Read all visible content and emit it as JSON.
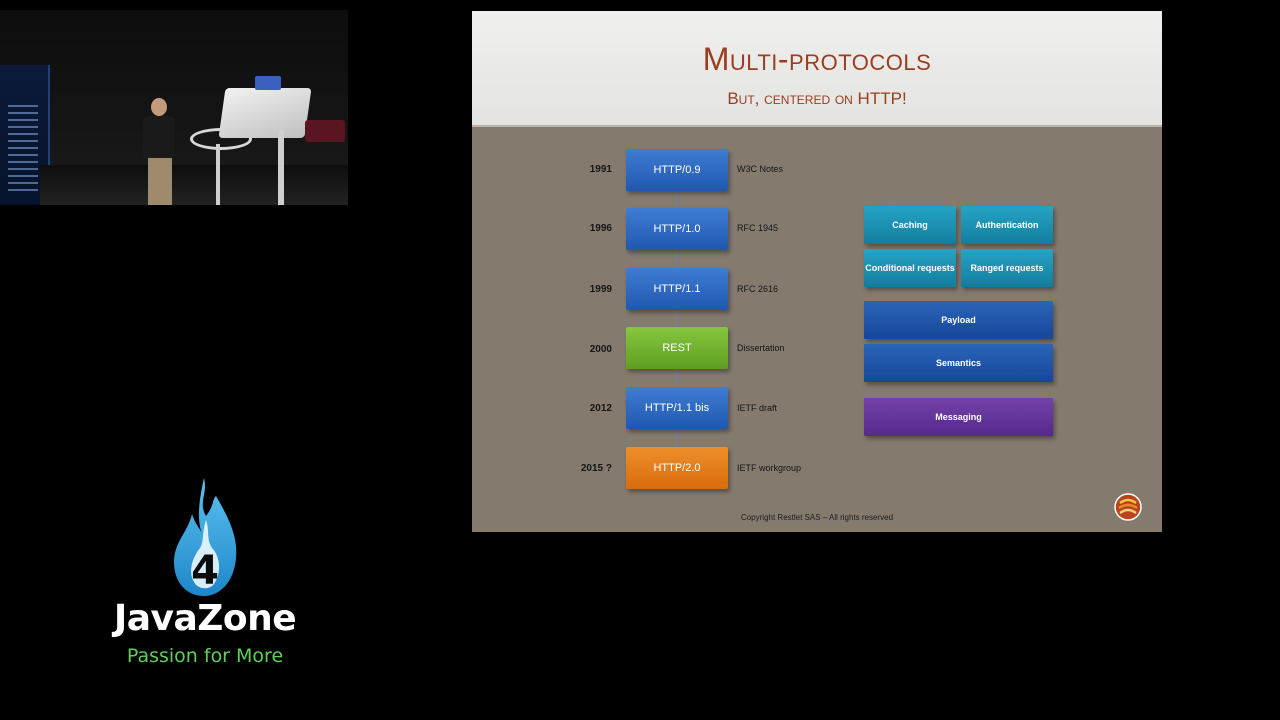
{
  "branding": {
    "badge_number": "4",
    "name": "JavaZone",
    "tagline": "Passion for More",
    "flame_color": "#2f9fdd",
    "tagline_color": "#5fcf5a"
  },
  "slide": {
    "title": "Multi-protocols",
    "subtitle": "But, centered on HTTP!",
    "title_color": "#9b3d1f",
    "timeline": [
      {
        "year": "1991",
        "label": "HTTP/0.9",
        "note": "W3C Notes",
        "color": "blue"
      },
      {
        "year": "1996",
        "label": "HTTP/1.0",
        "note": "RFC 1945",
        "color": "blue"
      },
      {
        "year": "1999",
        "label": "HTTP/1.1",
        "note": "RFC 2616",
        "color": "blue"
      },
      {
        "year": "2000",
        "label": "REST",
        "note": "Dissertation",
        "color": "green"
      },
      {
        "year": "2012",
        "label": "HTTP/1.1 bis",
        "note": "IETF draft",
        "color": "blue"
      },
      {
        "year": "2015 ?",
        "label": "HTTP/2.0",
        "note": "IETF workgroup",
        "color": "orange"
      }
    ],
    "stack": {
      "caching": "Caching",
      "authentication": "Authentication",
      "conditional_requests": "Conditional requests",
      "ranged_requests": "Ranged requests",
      "payload": "Payload",
      "semantics": "Semantics",
      "messaging": "Messaging"
    },
    "copyright": "Copyright Restlet SAS – All rights reserved"
  }
}
